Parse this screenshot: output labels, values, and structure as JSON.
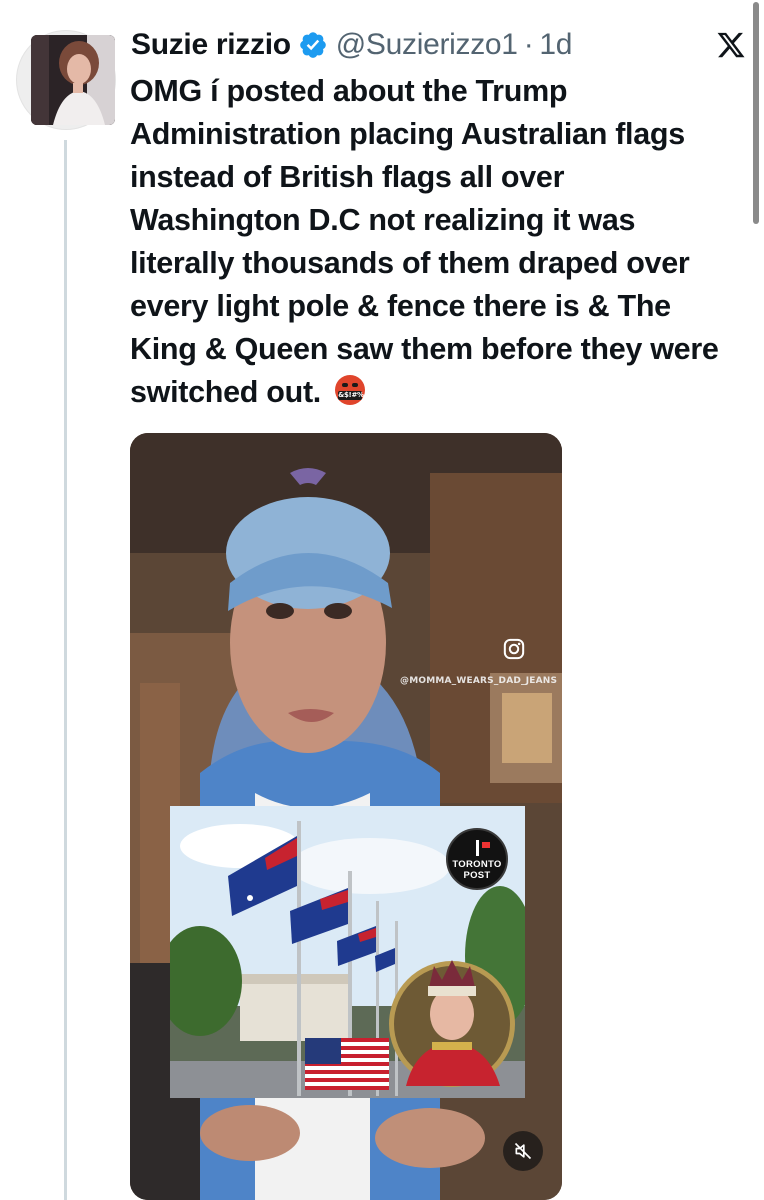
{
  "author": {
    "name": "Suzie rizzio",
    "handle": "@Suzierizzo1",
    "separator": "·",
    "time": "1d",
    "verified": true,
    "avatar_icon": "profile-photo"
  },
  "post": {
    "text": "OMG í posted about the Trump Administration placing Australian flags instead of British flags all over Washington D.C not realizing it was literally thousands of them draped over every light pole & fence there is & The King & Queen saw them before they were switched out.",
    "emoji_name": "face-with-symbols-on-mouth",
    "emoji_symbols": "&$!#%"
  },
  "media": {
    "type": "video",
    "watermark": "@MOMMA_WEARS_DAD_JEANS",
    "instagram_icon": "instagram-icon",
    "inset_badge": {
      "line1": "TORONTO",
      "line2": "POST"
    },
    "mute_icon": "speaker-muted-icon"
  },
  "icons": {
    "platform": "x-logo-icon",
    "verified": "verified-badge-icon"
  },
  "colors": {
    "text": "#0f1419",
    "secondary": "#536471",
    "verified": "#1d9bf0",
    "thread_line": "#cfd9de"
  }
}
